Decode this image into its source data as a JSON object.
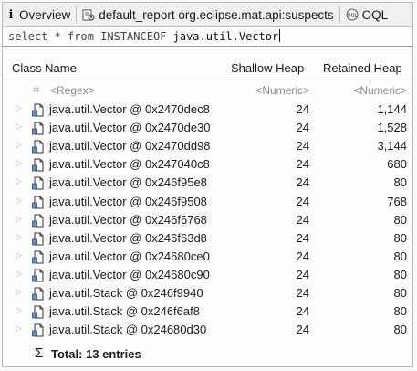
{
  "tabs": [
    {
      "label": "Overview",
      "icon": "info-icon"
    },
    {
      "label": "default_report  org.eclipse.mat.api:suspects",
      "icon": "report-icon"
    },
    {
      "label": "OQL",
      "icon": "oql-icon"
    }
  ],
  "query": {
    "prefix": "select * from INSTANCEOF ",
    "class_name": "java.util.Vector"
  },
  "table": {
    "columns": [
      "Class Name",
      "Shallow Heap",
      "Retained Heap"
    ],
    "filter": {
      "name": "<Regex>",
      "shallow": "<Numeric>",
      "retained": "<Numeric>"
    },
    "rows": [
      {
        "name": "java.util.Vector @ 0x2470dec8",
        "shallow": "24",
        "retained": "1,144"
      },
      {
        "name": "java.util.Vector @ 0x2470de30",
        "shallow": "24",
        "retained": "1,528"
      },
      {
        "name": "java.util.Vector @ 0x2470dd98",
        "shallow": "24",
        "retained": "3,144"
      },
      {
        "name": "java.util.Vector @ 0x247040c8",
        "shallow": "24",
        "retained": "680"
      },
      {
        "name": "java.util.Vector @ 0x246f95e8",
        "shallow": "24",
        "retained": "80"
      },
      {
        "name": "java.util.Vector @ 0x246f9508",
        "shallow": "24",
        "retained": "768"
      },
      {
        "name": "java.util.Vector @ 0x246f6768",
        "shallow": "24",
        "retained": "80"
      },
      {
        "name": "java.util.Vector @ 0x246f63d8",
        "shallow": "24",
        "retained": "80"
      },
      {
        "name": "java.util.Vector @ 0x24680ce0",
        "shallow": "24",
        "retained": "80"
      },
      {
        "name": "java.util.Vector @ 0x24680c90",
        "shallow": "24",
        "retained": "80"
      },
      {
        "name": "java.util.Stack @ 0x246f9940",
        "shallow": "24",
        "retained": "80"
      },
      {
        "name": "java.util.Stack @ 0x246f6af8",
        "shallow": "24",
        "retained": "80"
      },
      {
        "name": "java.util.Stack @ 0x24680d30",
        "shallow": "24",
        "retained": "80"
      }
    ],
    "total": "Total: 13 entries"
  }
}
